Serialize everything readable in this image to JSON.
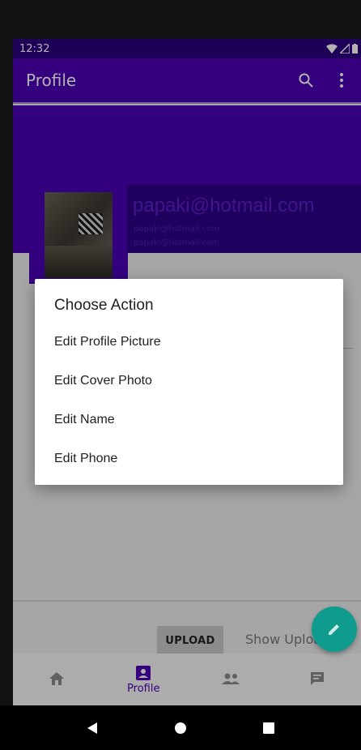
{
  "status_bar": {
    "time": "12:32"
  },
  "app_bar": {
    "title": "Profile"
  },
  "profile": {
    "email_large": "papaki@hotmail.com",
    "email_line_1": "papaki@hotmail.com",
    "email_line_2": "papaki@hotmail.com"
  },
  "upload": {
    "button_label": "UPLOAD",
    "show_uploads_label": "Show Uploa"
  },
  "dialog": {
    "title": "Choose Action",
    "items": [
      {
        "label": "Edit Profile Picture"
      },
      {
        "label": "Edit Cover Photo"
      },
      {
        "label": "Edit Name"
      },
      {
        "label": "Edit Phone"
      }
    ]
  },
  "bottom_nav": {
    "items": [
      {
        "icon": "home-icon",
        "label": ""
      },
      {
        "icon": "profile-icon",
        "label": "Profile"
      },
      {
        "icon": "users-icon",
        "label": ""
      },
      {
        "icon": "chat-icon",
        "label": ""
      }
    ]
  },
  "colors": {
    "primary": "#4b00b3",
    "primary_dark": "#2d0080",
    "fab": "#0f9b8e"
  }
}
